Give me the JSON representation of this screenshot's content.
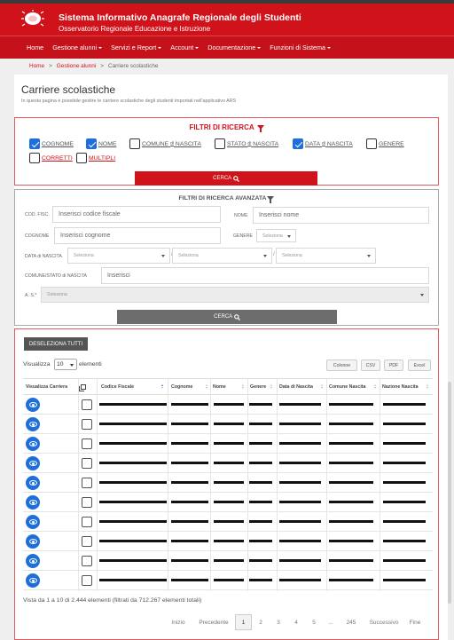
{
  "header": {
    "title": "Sistema Informativo Anagrafe Regionale degli Studenti",
    "subtitle": "Osservatorio Regionale Educazione e Istruzione"
  },
  "nav": {
    "items": [
      {
        "label": "Home",
        "dropdown": false
      },
      {
        "label": "Gestione alunni",
        "dropdown": true
      },
      {
        "label": "Servizi e Report",
        "dropdown": true
      },
      {
        "label": "Account",
        "dropdown": true
      },
      {
        "label": "Documentazione",
        "dropdown": true
      },
      {
        "label": "Funzioni di Sistema",
        "dropdown": true
      }
    ]
  },
  "breadcrumb": {
    "home": "Home",
    "section": "Gestione alunni",
    "current": "Carriere scolastiche"
  },
  "page": {
    "title": "Carriere scolastiche",
    "description": "In questa pagina è possibile gestire le carriere scolastiche degli studenti importati nell'applicativo ARS"
  },
  "filters": {
    "title": "FILTRI DI RICERCA",
    "checkboxes": [
      {
        "label": "COGNOME",
        "checked": true
      },
      {
        "label": "NOME",
        "checked": true
      },
      {
        "label": "COMUNE",
        "small": "di",
        "label2": "NASCITA",
        "checked": false
      },
      {
        "label": "STATO",
        "small": "di",
        "label2": "NASCITA",
        "checked": false
      },
      {
        "label": "DATA",
        "small": "di",
        "label2": "NASCITA",
        "checked": true
      },
      {
        "label": "GENERE",
        "checked": false
      },
      {
        "label": "CORRETTI",
        "checked": false
      },
      {
        "label": "MULTIPLI",
        "checked": false
      }
    ],
    "search_button": "CERCA"
  },
  "advanced": {
    "title": "FILTRI DI RICERCA AVANZATA",
    "cod_fisc_label": "COD. FISC.",
    "cod_fisc_placeholder": "Inserisci codice fiscale",
    "nome_label": "NOME",
    "nome_placeholder": "Inserisci nome",
    "cognome_label": "COGNOME",
    "cognome_placeholder": "Inserisci cognome",
    "genere_label": "GENERE",
    "genere_value": "Seleziona",
    "data_label": "DATA di NASCITA",
    "data_values": [
      "Seleziona",
      "Seleziona",
      "Seleziona"
    ],
    "comune_label": "COMUNE/STATO di NASCITA",
    "comune_placeholder": "Inserisci",
    "as_label": "A. S.*",
    "as_value": "Seleziona",
    "search_button": "CERCA"
  },
  "results": {
    "deselect_button": "DESELEZIONA TUTTI",
    "show_label": "Visualizza",
    "show_value": "10",
    "show_suffix": "elementi",
    "export_buttons": [
      "Colonne",
      "CSV",
      "PDF",
      "Excel"
    ],
    "columns": [
      "Visualizza Carriera",
      "",
      "Codice Fiscale",
      "Cognome",
      "Nome",
      "Genere",
      "Data di Nascita",
      "Comune Nascita",
      "Nazione Nascita"
    ],
    "row_count": 10,
    "entries_text": "Vista da 1 a 10 di 2.444 elementi (filtrati da 712.267 elementi totali)",
    "pagination": [
      "Inizio",
      "Precedente",
      "1",
      "2",
      "3",
      "4",
      "5",
      "...",
      "245",
      "Successivo",
      "Fine"
    ],
    "current_page": "1"
  },
  "colors": {
    "brand_red": "#d0121b",
    "action_blue": "#1e6fdc",
    "gray_button": "#6d6d6d"
  }
}
